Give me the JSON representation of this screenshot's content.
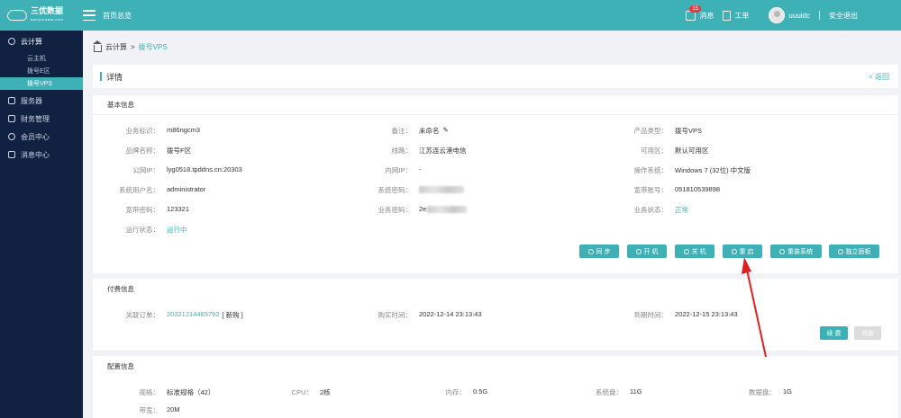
{
  "header": {
    "brand": "三优数据",
    "brand_sub": "sanyoudata.com",
    "home_label": "首页总览",
    "message_label": "消息",
    "message_count": "15",
    "ticket_label": "工单",
    "username": "uuuidc",
    "logout_label": "安全退出"
  },
  "sidebar": {
    "cloud": "云计算",
    "cloud_items": [
      "云主机",
      "拨号E区",
      "拨号VPS"
    ],
    "server": "服务器",
    "finance": "财务管理",
    "member": "会员中心",
    "message": "消息中心"
  },
  "breadcrumb": {
    "root": "云计算",
    "sep": ">",
    "current": "拨号VPS"
  },
  "page": {
    "title": "详情",
    "back": "<  返回"
  },
  "basic": {
    "heading": "基本信息",
    "fields": [
      {
        "label": "业务标识：",
        "value": "m86ngcm3"
      },
      {
        "label": "备注：",
        "value": "未命名"
      },
      {
        "label": "产品类型：",
        "value": "拨号VPS"
      },
      {
        "label": "品牌名称：",
        "value": "拨号F区"
      },
      {
        "label": "线路：",
        "value": "江苏连云港电信"
      },
      {
        "label": "可用区：",
        "value": "默认可用区"
      },
      {
        "label": "公网IP：",
        "value": "lyg0518.tpddns.cn:20303"
      },
      {
        "label": "内网IP：",
        "value": "-"
      },
      {
        "label": "操作系统：",
        "value": "Windows 7 (32位) 中文版"
      },
      {
        "label": "系统用户名：",
        "value": "administrator"
      },
      {
        "label": "系统密码：",
        "value": ""
      },
      {
        "label": "宽带账号：",
        "value": "051810539898"
      },
      {
        "label": "宽带密码：",
        "value": "123321"
      },
      {
        "label": "业务密码：",
        "value": "2e"
      },
      {
        "label": "业务状态：",
        "value": "正常"
      },
      {
        "label": "运行状态：",
        "value": "运行中"
      }
    ],
    "buttons": [
      "同 步",
      "开 机",
      "关 机",
      "重 启",
      "重装系统",
      "独立面板"
    ]
  },
  "payment": {
    "heading": "付费信息",
    "order_label": "关联订单：",
    "order_no": "20221214465792",
    "order_tag": "[ 新购 ]",
    "buy_label": "购买时间：",
    "buy_time": "2022-12-14 23:13:43",
    "expire_label": "到期时间：",
    "expire_time": "2022-12-15 23:13:43",
    "renew": "续 费",
    "refund": "退款"
  },
  "config": {
    "heading": "配置信息",
    "fields": [
      {
        "label": "规格：",
        "value": "标准规格（42）"
      },
      {
        "label": "CPU：",
        "value": "2核"
      },
      {
        "label": "内存：",
        "value": "0.5G"
      },
      {
        "label": "系统盘：",
        "value": "11G"
      },
      {
        "label": "数据盘：",
        "value": "1G"
      },
      {
        "label": "带宽：",
        "value": "20M"
      }
    ]
  },
  "colors": {
    "accent": "#3eb1b6",
    "sidebar": "#112142",
    "annotation": "#e02020"
  }
}
